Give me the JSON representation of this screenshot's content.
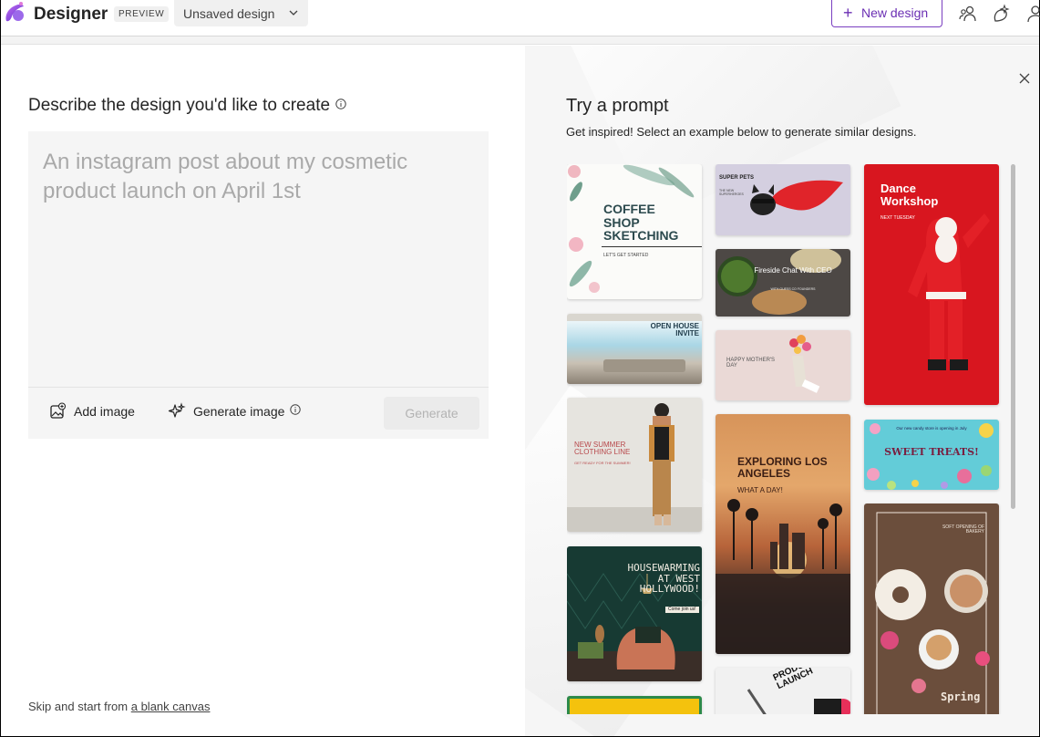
{
  "header": {
    "brand": "Designer",
    "preview_badge": "PREVIEW",
    "design_name": "Unsaved design",
    "new_design_label": "New design"
  },
  "left": {
    "title": "Describe the design you'd like to create",
    "prompt_placeholder": "An instagram post about my cosmetic product launch on April 1st",
    "add_image_label": "Add image",
    "generate_image_label": "Generate image",
    "generate_label": "Generate",
    "skip_text": "Skip and start from",
    "skip_link": "a blank canvas"
  },
  "right": {
    "title": "Try a prompt",
    "subtitle": "Get inspired! Select an example below to generate similar designs.",
    "cards": {
      "coffee": {
        "title": "COFFEE SHOP SKETCHING",
        "sub": "LET'S GET STARTED"
      },
      "open_house": {
        "title": "OPEN HOUSE INVITE"
      },
      "summer": {
        "title": "NEW SUMMER CLOTHING LINE",
        "sub": "GET READY FOR THE SUMMER!"
      },
      "housewarming": {
        "title": "HOUSEWARMING AT WEST HOLLYWOOD!",
        "sub": "Come join us!"
      },
      "super_pets": {
        "title": "SUPER PETS",
        "sub": "THE NEW SUPERHEROES"
      },
      "fireside": {
        "title": "Fireside Chat With CEO",
        "sub": "WITH GUESS CO FOUNDERS"
      },
      "flowers": {
        "title": "HAPPY MOTHER'S DAY"
      },
      "la": {
        "title": "EXPLORING LOS ANGELES",
        "sub": "WHAT A DAY!"
      },
      "product": {
        "title": "PRODUCT LAUNCH"
      },
      "dance": {
        "title": "Dance Workshop",
        "sub": "NEXT TUESDAY"
      },
      "sweet": {
        "title": "SWEET TREATS!",
        "sub": "Our new candy store is opening in July"
      },
      "spring": {
        "title": "Spring",
        "sub": "SOFT OPENING OF BAKERY"
      }
    }
  },
  "colors": {
    "accent": "#6b2fb3",
    "generate_disabled_bg": "#ebebeb",
    "prompt_bg": "#f5f5f5"
  },
  "icons": {
    "logo": "designer-logo-icon",
    "chevron": "chevron-down-icon",
    "share": "share-people-icon",
    "magic": "sparkle-character-icon",
    "account": "account-icon",
    "close": "close-icon",
    "info": "info-icon",
    "add_image": "image-add-icon",
    "generate_image": "sparkle-icon"
  }
}
